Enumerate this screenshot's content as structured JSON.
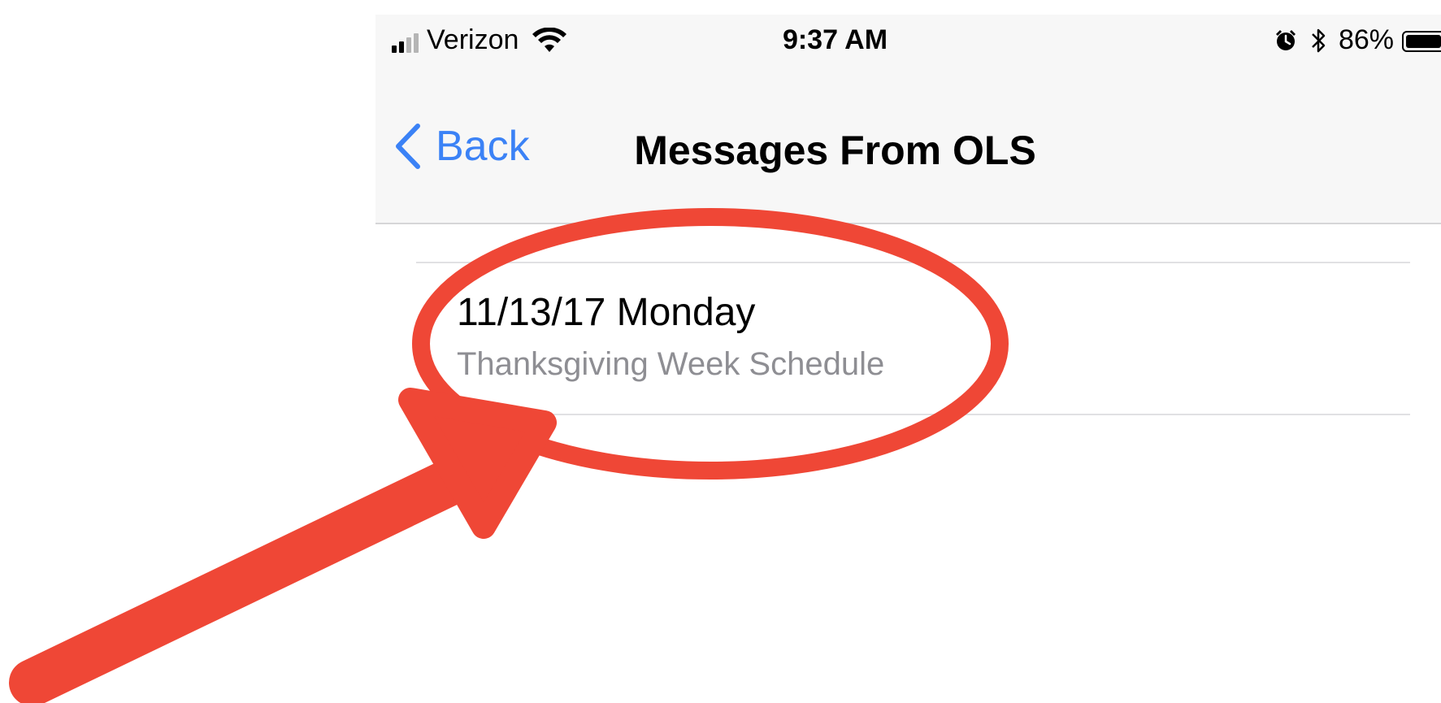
{
  "status_bar": {
    "carrier": "Verizon",
    "time": "9:37 AM",
    "battery_percent_label": "86%",
    "battery_level": 0.86,
    "icons": [
      "signal-bars-icon",
      "wifi-icon",
      "alarm-icon",
      "bluetooth-icon",
      "battery-icon"
    ]
  },
  "nav": {
    "back_label": "Back",
    "title": "Messages From OLS",
    "accent_color": "#3b82f6"
  },
  "messages": [
    {
      "title": "11/13/17 Monday",
      "subtitle": "Thanksgiving Week Schedule"
    }
  ],
  "annotation": {
    "color": "#ef4736",
    "shapes": [
      "circle-highlight",
      "pointer-arrow"
    ]
  }
}
